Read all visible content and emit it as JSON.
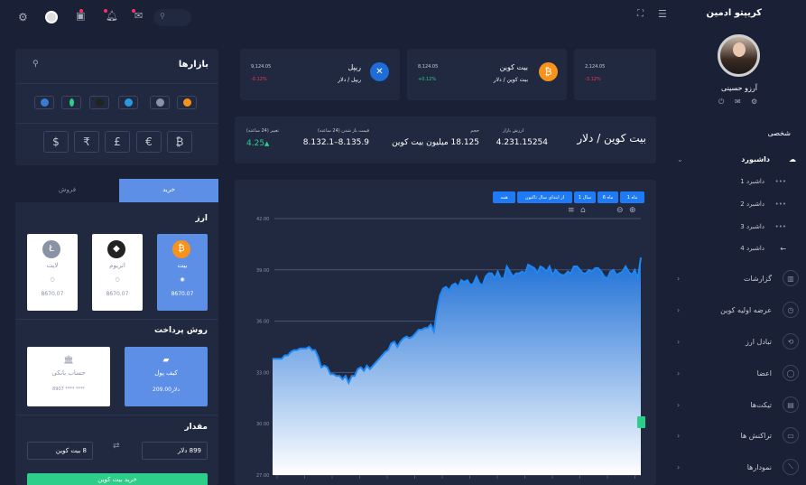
{
  "brand": {
    "title": "کریپتو ادمین",
    "user_name": "آرزو حسینی"
  },
  "sidebar": {
    "section_label": "شخصی",
    "dashboard_label": "داشبورد",
    "sub_items": [
      "داشبرد 1",
      "داشبرد 2",
      "داشبرد 3",
      "داشبرد 4"
    ],
    "items": [
      {
        "label": "گزارشات",
        "icon": "chart-icon"
      },
      {
        "label": "عرضه اولیه کوین",
        "icon": "clock-icon"
      },
      {
        "label": "تبادل ارز",
        "icon": "exchange-icon"
      },
      {
        "label": "اعضا",
        "icon": "user-icon"
      },
      {
        "label": "تیکت‌ها",
        "icon": "ticket-icon"
      },
      {
        "label": "تراکنش ها",
        "icon": "wallet-icon"
      },
      {
        "label": "نمودارها",
        "icon": "graph-icon"
      }
    ]
  },
  "tickers": [
    {
      "name": "",
      "pair": "",
      "value": "2,124.05",
      "change": "-3.12%",
      "change_dir": "down"
    },
    {
      "name": "بیت کوین",
      "pair": "بیت کوین / دلار",
      "value": "8,124.05",
      "change": "+0.12%",
      "change_dir": "up",
      "icon_color": "#f7931a",
      "icon_text": "₿"
    },
    {
      "name": "ریپل",
      "pair": "ریپل / دلار",
      "value": "9,124.05",
      "change": "-0.12%",
      "change_dir": "down",
      "icon_color": "#1e6cd6",
      "icon_text": "✕"
    }
  ],
  "markets": {
    "title": "بازارها",
    "currencies": [
      "$",
      "₹",
      "£",
      "€",
      "₿"
    ],
    "coin_colors": [
      "#f7931a",
      "#8a92a6",
      "#2a98dc",
      "#222",
      "#2dce89",
      "#3a7bd5"
    ]
  },
  "stats": {
    "pair_title": "بیت کوین / دلار",
    "market_value_label": "ارزش بازار",
    "market_value": "4.231.15254",
    "volume_label": "حجم",
    "volume": "18.125 میلیون بیت کوین",
    "range_label": "قیمت باز شدن (24 ساعته)",
    "range": "8.132.1–8.135.9",
    "change_label": "تغییر (24 ساعته)",
    "change": "4.25"
  },
  "trade": {
    "tab_buy": "خرید",
    "tab_sell": "فروش",
    "currency_section": "ارز",
    "coins": [
      {
        "name": "بیت",
        "symbol": "₿",
        "value": "8670.07",
        "selected": true,
        "color": "#f7931a"
      },
      {
        "name": "اتریوم",
        "symbol": "◆",
        "value": "8670.07",
        "selected": false,
        "color": "#222"
      },
      {
        "name": "لایت",
        "symbol": "Ł",
        "value": "8670.07",
        "selected": false,
        "color": "#8a92a6"
      }
    ],
    "payment_section": "روش پرداخت",
    "wallet_label": "کیف پول",
    "wallet_value": "209.00دلار",
    "bank_label": "حساب بانکی",
    "bank_value": "8907 **** ****",
    "amount_section": "مقدار",
    "amount_usd": "899 دلار",
    "amount_btc": "8 بیت کوین",
    "buy_button": "خرید بیت کوین"
  },
  "chart_controls": [
    "1 ماه",
    "6 ماه",
    "1 سال",
    "از ابتدای سال تاکنون",
    "همه"
  ],
  "chart_data": {
    "type": "area",
    "ylim": [
      27.0,
      42.0
    ],
    "yticks": [
      "42.00",
      "39.00",
      "36.00",
      "33.00",
      "30.00",
      "27.00"
    ],
    "values": [
      33.8,
      33.8,
      33.8,
      33.8,
      34.0,
      34.0,
      34.2,
      34.3,
      34.3,
      34.4,
      34.4,
      34.4,
      34.5,
      34.3,
      34.3,
      33.9,
      33.3,
      33.4,
      33.3,
      32.9,
      32.9,
      32.8,
      32.8,
      32.6,
      32.8,
      32.4,
      32.8,
      32.8,
      33.2,
      33.3,
      33.1,
      33.4,
      33.2,
      33.4,
      33.6,
      33.8,
      34.0,
      34.2,
      34.3,
      34.7,
      34.8,
      34.5,
      34.8,
      35.0,
      35.1,
      35.0,
      35.1,
      35.3,
      35.5,
      35.5,
      35.6,
      35.6,
      35.8,
      35.4,
      36.6,
      37.5,
      37.9,
      38.0,
      37.8,
      38.1,
      38.2,
      38.0,
      38.4,
      38.3,
      38.4,
      38.1,
      38.2,
      38.6,
      38.2,
      38.1,
      38.6,
      38.8,
      38.8,
      38.5,
      38.9,
      38.5,
      38.5,
      39.2,
      38.9,
      38.6,
      38.8,
      38.8,
      38.9,
      38.8,
      39.3,
      39.2,
      39.1,
      38.8,
      39.2,
      39.1,
      38.9,
      39.2,
      38.7,
      39.0,
      38.8,
      38.7,
      38.7,
      38.9,
      38.8,
      39.2,
      39.2,
      39.0,
      38.8,
      38.8,
      39.0,
      38.9,
      39.1,
      39.1,
      38.9,
      38.6,
      38.5,
      38.9,
      39.0,
      38.7,
      38.8,
      38.9,
      39.2,
      38.9,
      38.7,
      39.0,
      38.5,
      39.7
    ]
  }
}
